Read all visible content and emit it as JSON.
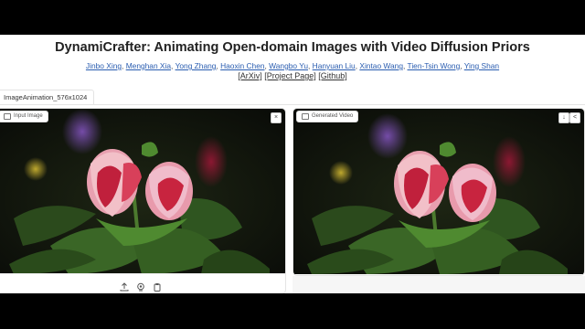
{
  "header": {
    "title": "DynamiCrafter: Animating Open-domain Images with Video Diffusion Priors",
    "authors": [
      "Jinbo Xing",
      "Menghan Xia",
      "Yong Zhang",
      "Haoxin Chen",
      "Wangbo Yu",
      "Hanyuan Liu",
      "Xintao Wang",
      "Tien-Tsin Wong",
      "Ying Shan"
    ],
    "links": [
      "[ArXiv]",
      "[Project Page]",
      "[Github]"
    ]
  },
  "tabs": [
    {
      "label": "ImageAnimation_576x1024"
    }
  ],
  "input_panel": {
    "label": "Input Image",
    "close_glyph": "×"
  },
  "output_panel": {
    "label": "Generated Video",
    "download_glyph": "↓",
    "share_glyph": "<"
  },
  "icons": {
    "upload": "upload-icon",
    "webcam": "webcam-icon",
    "clipboard": "clipboard-icon",
    "image": "image-icon",
    "video": "video-icon"
  }
}
